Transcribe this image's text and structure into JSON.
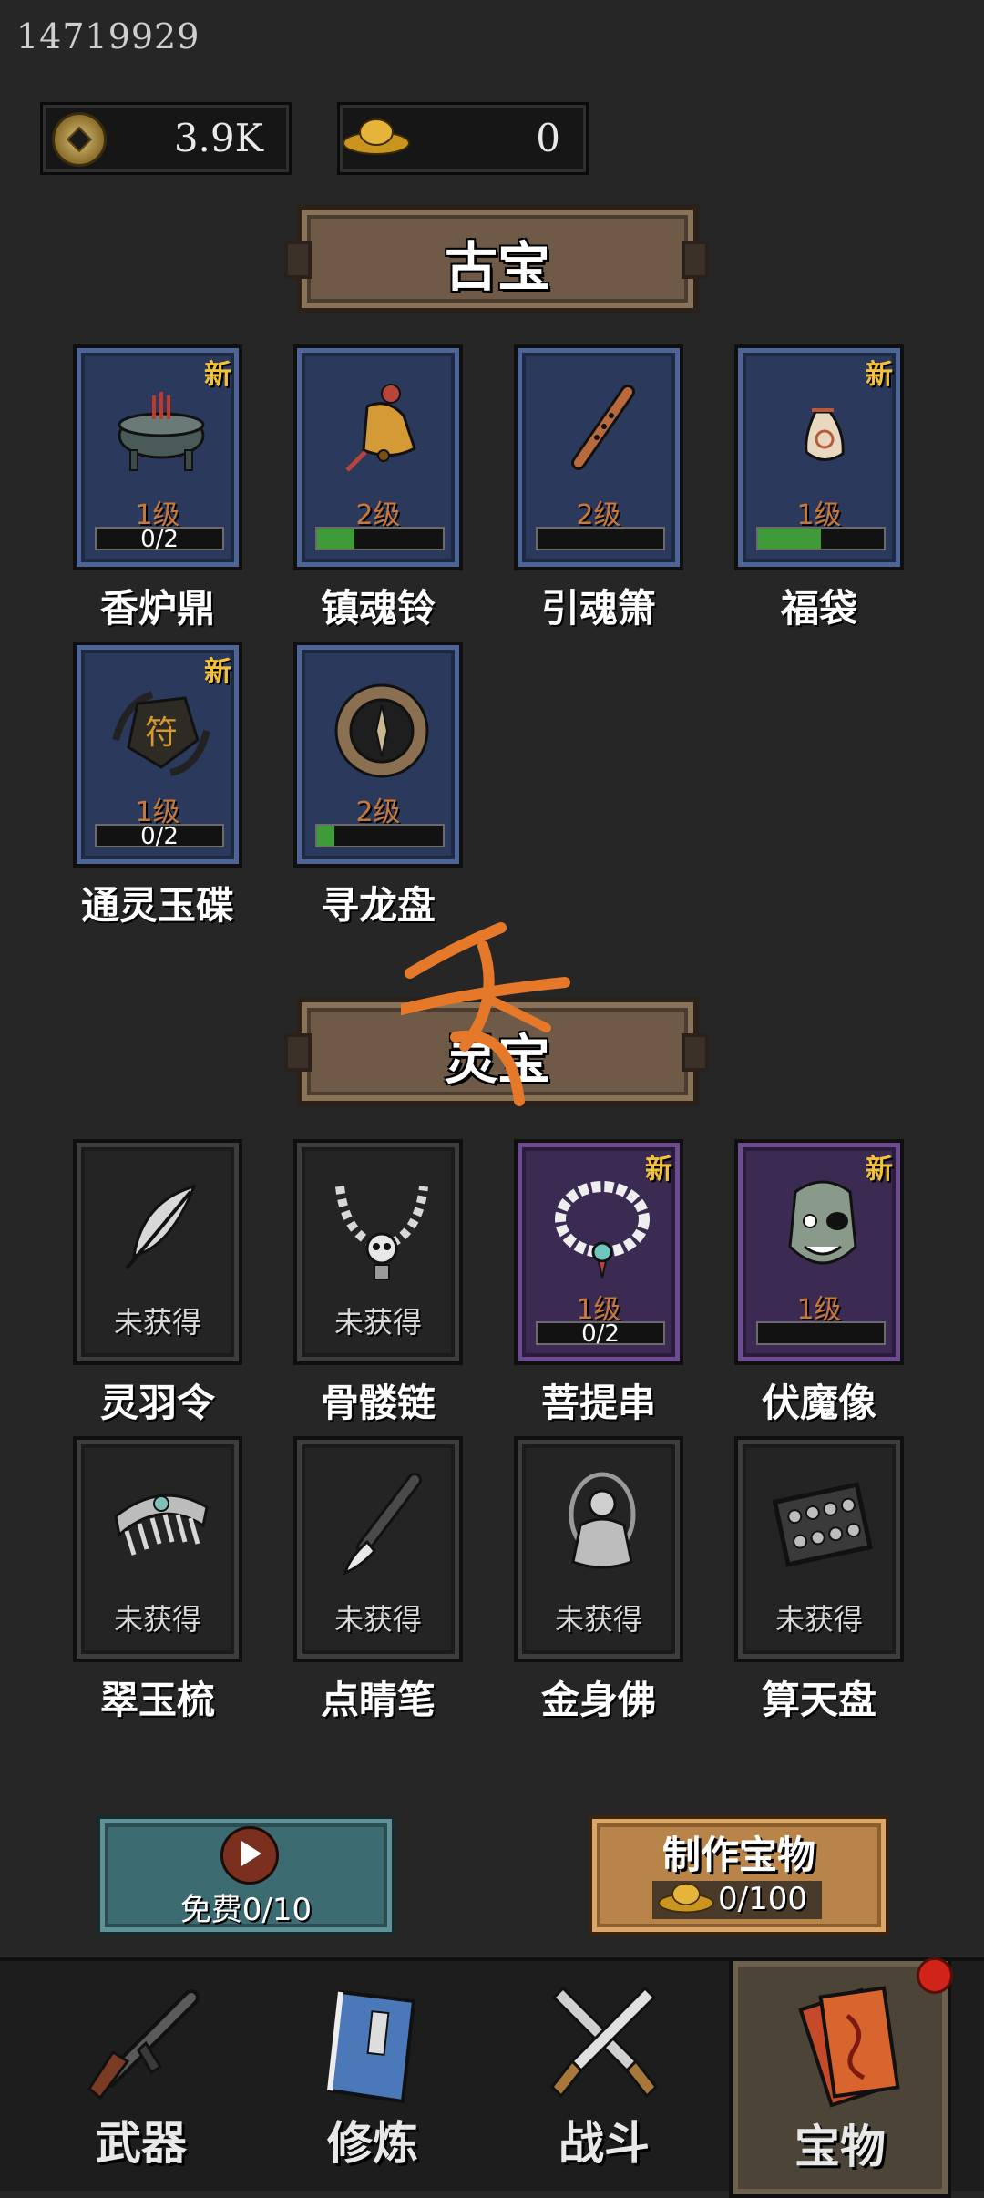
{
  "user_id": "14719929",
  "currency": {
    "coins": "3.9K",
    "gold": "0"
  },
  "sections": [
    {
      "title": "古宝"
    },
    {
      "title": "灵宝"
    }
  ],
  "ancient_items": [
    {
      "name": "香炉鼎",
      "level": "1级",
      "progress_text": "0/2",
      "progress": 0.0,
      "new_label": "新",
      "icon": "incense-burner-icon"
    },
    {
      "name": "镇魂铃",
      "level": "2级",
      "progress_text": "",
      "progress": 0.3,
      "new_label": "",
      "icon": "bell-icon"
    },
    {
      "name": "引魂箫",
      "level": "2级",
      "progress_text": "",
      "progress": 0.0,
      "new_label": "",
      "icon": "flute-icon"
    },
    {
      "name": "福袋",
      "level": "1级",
      "progress_text": "",
      "progress": 0.5,
      "new_label": "新",
      "icon": "lucky-bag-icon"
    },
    {
      "name": "通灵玉碟",
      "level": "1级",
      "progress_text": "0/2",
      "progress": 0.0,
      "new_label": "新",
      "icon": "jade-disc-icon"
    },
    {
      "name": "寻龙盘",
      "level": "2级",
      "progress_text": "",
      "progress": 0.14,
      "new_label": "",
      "icon": "compass-icon"
    }
  ],
  "spirit_items": [
    {
      "name": "灵羽令",
      "status": "未获得",
      "icon": "feather-icon"
    },
    {
      "name": "骨髅链",
      "status": "未获得",
      "icon": "skull-necklace-icon"
    },
    {
      "name": "菩提串",
      "level": "1级",
      "progress_text": "0/2",
      "progress": 0.0,
      "new_label": "新",
      "icon": "prayer-beads-icon"
    },
    {
      "name": "伏魔像",
      "level": "1级",
      "progress_text": "",
      "progress": 0.0,
      "new_label": "新",
      "icon": "demon-mask-icon"
    },
    {
      "name": "翠玉梳",
      "status": "未获得",
      "icon": "comb-icon"
    },
    {
      "name": "点睛笔",
      "status": "未获得",
      "icon": "brush-icon"
    },
    {
      "name": "金身佛",
      "status": "未获得",
      "icon": "buddha-icon"
    },
    {
      "name": "算天盘",
      "status": "未获得",
      "icon": "abacus-icon"
    }
  ],
  "free_button": {
    "label": "免费0/10"
  },
  "make_button": {
    "title": "制作宝物",
    "cost": "0/100"
  },
  "nav": [
    {
      "label": "武器",
      "icon": "rifle-icon"
    },
    {
      "label": "修炼",
      "icon": "book-icon"
    },
    {
      "label": "战斗",
      "icon": "crossed-swords-icon"
    },
    {
      "label": "宝物",
      "icon": "talisman-icon"
    }
  ],
  "colors": {
    "background": "#262626",
    "card_blue": "#2b3a5c",
    "card_purple": "#3b2a52",
    "new_badge": "#f3c23a",
    "level_text": "#c9783a",
    "progress_green": "#3f9a3a",
    "notification": "#d0241b"
  }
}
